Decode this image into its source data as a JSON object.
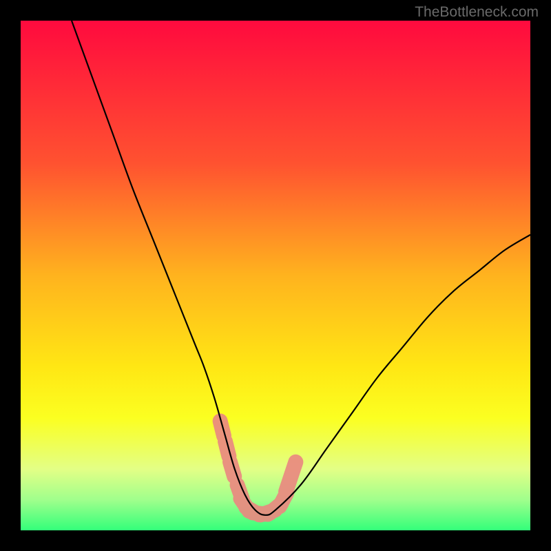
{
  "watermark": "TheBottleneck.com",
  "chart_data": {
    "type": "line",
    "title": "",
    "xlabel": "",
    "ylabel": "",
    "xlim": [
      0,
      100
    ],
    "ylim": [
      0,
      100
    ],
    "gradient_stops": [
      {
        "offset": 0,
        "color": "#ff0a3e"
      },
      {
        "offset": 28,
        "color": "#ff5230"
      },
      {
        "offset": 50,
        "color": "#ffb31e"
      },
      {
        "offset": 68,
        "color": "#ffe714"
      },
      {
        "offset": 78,
        "color": "#fbff21"
      },
      {
        "offset": 88,
        "color": "#e3ff86"
      },
      {
        "offset": 94,
        "color": "#a0ff8c"
      },
      {
        "offset": 100,
        "color": "#33ff7a"
      }
    ],
    "series": [
      {
        "name": "bottleneck-curve",
        "x": [
          10,
          14,
          18,
          22,
          26,
          30,
          34,
          36,
          38,
          40,
          42,
          44,
          46,
          48,
          50,
          55,
          60,
          65,
          70,
          75,
          80,
          85,
          90,
          95,
          100
        ],
        "y": [
          100,
          89,
          78,
          67,
          57,
          47,
          37,
          32,
          26,
          19,
          12,
          7,
          4,
          3,
          4,
          9,
          16,
          23,
          30,
          36,
          42,
          47,
          51,
          55,
          58
        ]
      }
    ],
    "markers": {
      "name": "highlight-segment",
      "color": "#e98980",
      "points": [
        {
          "x": 39.5,
          "y": 20
        },
        {
          "x": 40.5,
          "y": 16
        },
        {
          "x": 41.5,
          "y": 12
        },
        {
          "x": 43,
          "y": 7.5
        },
        {
          "x": 44,
          "y": 5
        },
        {
          "x": 45.5,
          "y": 3.8
        },
        {
          "x": 47,
          "y": 3.3
        },
        {
          "x": 48.5,
          "y": 3.5
        },
        {
          "x": 50,
          "y": 4.3
        },
        {
          "x": 51.5,
          "y": 6
        },
        {
          "x": 52.5,
          "y": 9
        },
        {
          "x": 53.5,
          "y": 12
        }
      ]
    }
  }
}
